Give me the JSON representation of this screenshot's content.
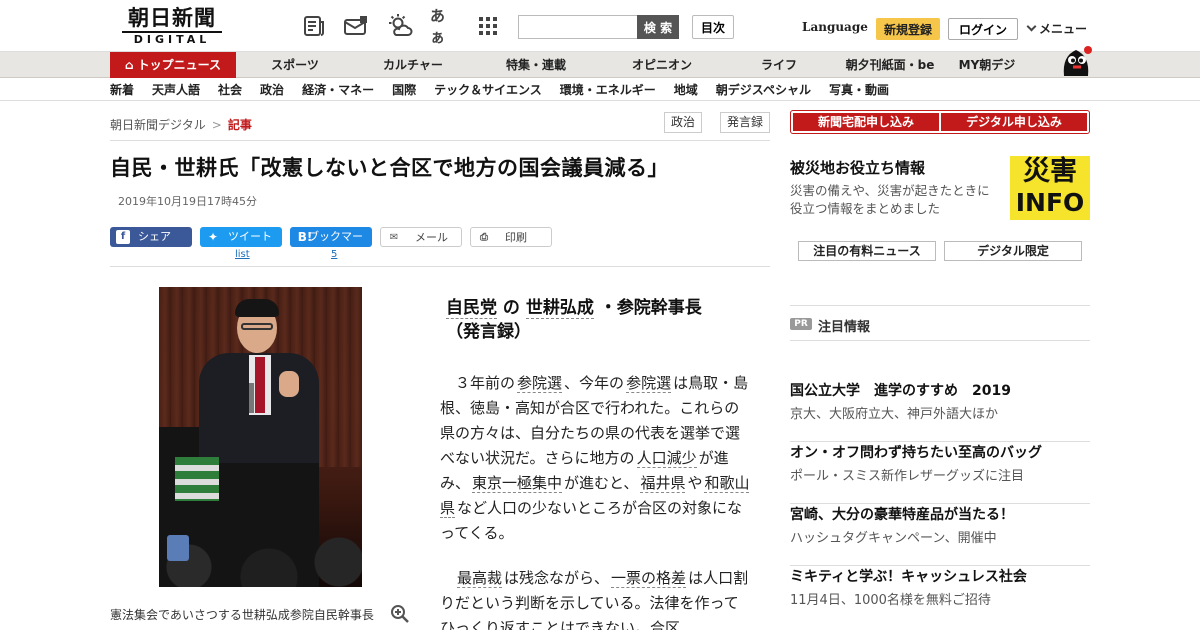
{
  "header": {
    "logo_jp": "朝日新聞",
    "logo_en": "DIGITAL",
    "font_size_label": "あぁ",
    "search": {
      "placeholder": "",
      "button_label": "検 索"
    },
    "toc_label": "目次",
    "language_label": "Language",
    "register_label": "新規登録",
    "login_label": "ログイン",
    "menu_label": "メニュー"
  },
  "nav_primary": [
    {
      "label": "トップニュース",
      "active": true
    },
    {
      "label": "スポーツ"
    },
    {
      "label": "カルチャー"
    },
    {
      "label": "特集・連載"
    },
    {
      "label": "オピニオン"
    },
    {
      "label": "ライフ"
    },
    {
      "label": "朝夕刊紙面・be"
    },
    {
      "label": "MY朝デジ"
    }
  ],
  "nav_secondary": [
    "新着",
    "天声人語",
    "社会",
    "政治",
    "経済・マネー",
    "国際",
    "テック＆サイエンス",
    "環境・エネルギー",
    "地域",
    "朝デジスペシャル",
    "写真・動画"
  ],
  "breadcrumb": {
    "home": "朝日新聞デジタル",
    "separator": ">",
    "current": "記事"
  },
  "tags": [
    "政治",
    "発言録"
  ],
  "article": {
    "headline": "自民・世耕氏「改憲しないと合区で地方の国会議員減る」",
    "timestamp": "2019年10月19日17時45分",
    "share": {
      "facebook": "シェア",
      "twitter": "ツイート",
      "twitter_count": "list",
      "hatena": "ブックマーク",
      "hatena_count": "5",
      "mail": "メール",
      "print": "印刷"
    },
    "caption": "憲法集会であいさつする世耕弘成参院自民幹事長",
    "lead": {
      "party": "自民党",
      "of": " の ",
      "name": "世耕弘成",
      "role": " ・参院幹事長",
      "label": "（発言録）"
    },
    "para1": {
      "t1": "３年前の",
      "k1": "参院選",
      "t2": "、今年の",
      "k2": "参院選",
      "t3": "は鳥取・島根、徳島・高知が合区で行われた。これらの県の方々は、自分たちの県の代表を選挙で選べない状況だ。さらに地方の",
      "k3": "人口減少",
      "t4": "が進み、",
      "k4": "東京一極集中",
      "t5": "が進むと、",
      "k5": "福井県",
      "t6": "や",
      "k6": "和歌山県",
      "t7": "など人口の少ないところが合区の対象になってくる。"
    },
    "para2": {
      "k1": "最高裁",
      "t1": "は残念ながら、",
      "k2": "一票の格差",
      "t2": "は人口割りだという判断を示している。法律を作ってひっくり返すことはできない。合区"
    }
  },
  "sidebar": {
    "subscribe_home": "新聞宅配申し込み",
    "subscribe_digital": "デジタル申し込み",
    "disaster_title": "被災地お役立ち情報",
    "disaster_desc": "災害の備えや、災害が起きたときに役立つ情報をまとめました",
    "disaster_banner_kanji": "災害",
    "disaster_banner_info": "INFO",
    "paid_news_label": "注目の有料ニュース",
    "digital_only_label": "デジタル限定",
    "pr_badge": "PR",
    "pr_title": "注目情報",
    "ads": [
      {
        "title": "国公立大学　進学のすすめ　2019",
        "sub": "京大、大阪府立大、神戸外語大ほか"
      },
      {
        "title": "オン・オフ問わず持ちたい至高のバッグ",
        "sub": "ポール・スミス新作レザーグッズに注目"
      },
      {
        "title": "宮崎、大分の豪華特産品が当たる！",
        "sub": "ハッシュタグキャンペーン、開催中"
      },
      {
        "title": "ミキティと学ぶ！キャッシュレス社会",
        "sub": "11月4日、1000名様を無料ご招待"
      }
    ]
  },
  "colors": {
    "brand_red": "#c21a1a",
    "register_yellow": "#f5c64a",
    "facebook": "#3b5998",
    "twitter": "#1d9bf0",
    "hatena": "#1e88e5",
    "disaster_yellow": "#f5e32c"
  }
}
